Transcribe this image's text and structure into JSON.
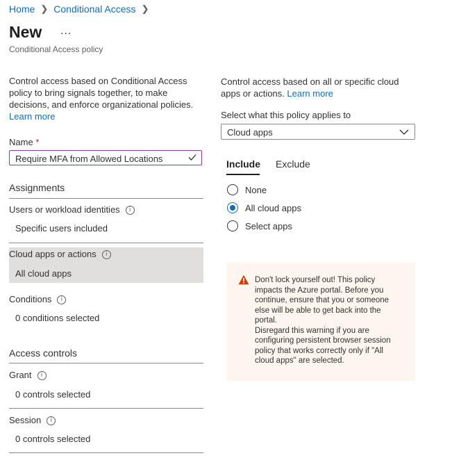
{
  "breadcrumb": {
    "items": [
      "Home",
      "Conditional Access"
    ]
  },
  "header": {
    "title": "New",
    "more_label": "...",
    "subtitle": "Conditional Access policy"
  },
  "left": {
    "description": "Control access based on Conditional Access policy to bring signals together, to make decisions, and enforce organizational policies.",
    "learn_more": "Learn more",
    "name_label": "Name",
    "required_mark": "*",
    "name_value": "Require MFA from Allowed Locations",
    "assignments_heading": "Assignments",
    "users_label": "Users or workload identities",
    "users_value": "Specific users included",
    "cloud_label": "Cloud apps or actions",
    "cloud_value": "All cloud apps",
    "conditions_label": "Conditions",
    "conditions_value": "0 conditions selected",
    "access_heading": "Access controls",
    "grant_label": "Grant",
    "grant_value": "0 controls selected",
    "session_label": "Session",
    "session_value": "0 controls selected"
  },
  "right": {
    "description": "Control access based on all or specific cloud apps or actions.",
    "learn_more": "Learn more",
    "applies_label": "Select what this policy applies to",
    "applies_value": "Cloud apps",
    "tabs": [
      {
        "label": "Include",
        "active": true
      },
      {
        "label": "Exclude",
        "active": false
      }
    ],
    "radios": [
      {
        "label": "None",
        "selected": false
      },
      {
        "label": "All cloud apps",
        "selected": true
      },
      {
        "label": "Select apps",
        "selected": false
      }
    ],
    "warning": {
      "icon": "warning-icon",
      "text": "Don't lock yourself out! This policy impacts the Azure portal. Before you continue, ensure that you or someone else will be able to get back into the portal.",
      "text2": "Disregard this warning if you are configuring persistent browser session policy that works correctly only if \"All cloud apps\" are selected."
    }
  },
  "colors": {
    "link": "#0f6cbd",
    "selected_row": "#e1dfdd",
    "warning_bg": "#fdf6ee",
    "warning_icon": "#d83b01",
    "textbox_border": "#8a3fa0"
  }
}
